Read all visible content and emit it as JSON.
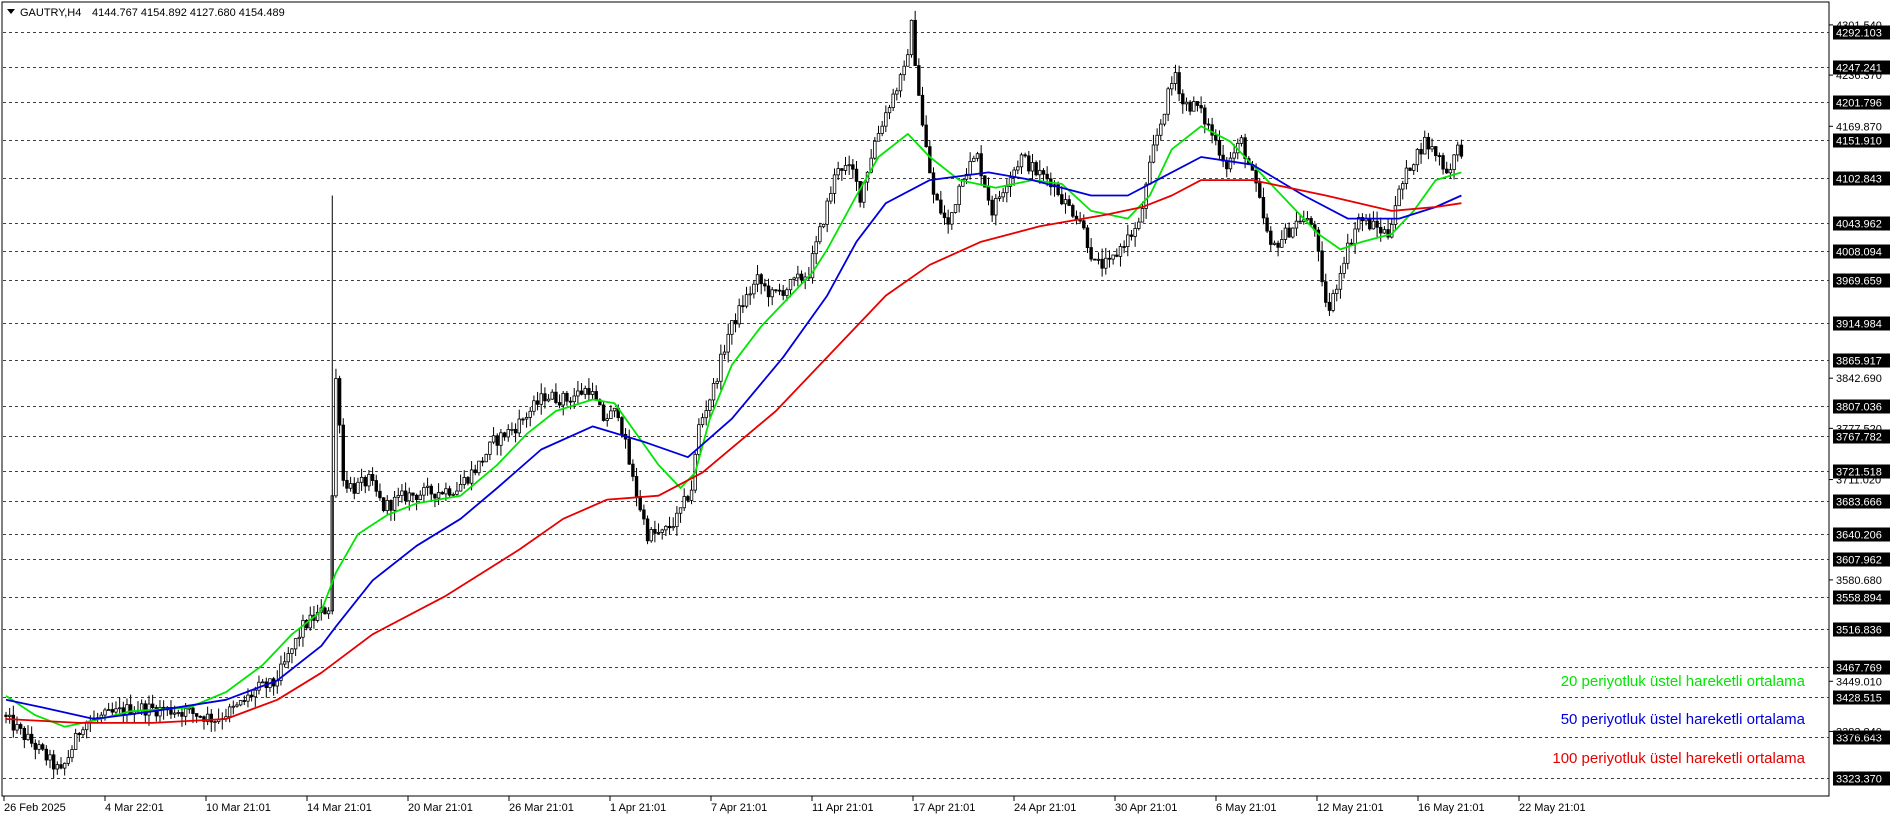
{
  "header": {
    "symbol": "GAUTRY,H4",
    "ohlc": "4144.767 4154.892 4127.680 4154.489"
  },
  "colors": {
    "background": "#ffffff",
    "grid": "#000000",
    "candle": "#000000",
    "ema20": "#00e600",
    "ema50": "#0000dd",
    "ema100": "#e60000"
  },
  "chart_data": {
    "type": "line",
    "timeframe": "H4",
    "ylim": [
      3300,
      4330
    ],
    "grid": true,
    "legend_position": "bottom-right",
    "price_levels": [
      4292.103,
      4247.241,
      4201.796,
      4151.91,
      4102.843,
      4043.962,
      4008.094,
      3969.659,
      3914.984,
      3865.917,
      3807.036,
      3767.782,
      3721.518,
      3683.666,
      3640.206,
      3607.962,
      3558.894,
      3516.836,
      3467.769,
      3428.515,
      3376.643,
      3323.37
    ],
    "scale_labels": [
      "4301.540",
      "4236.370",
      "4169.870",
      "3842.690",
      "3777.520",
      "3711.020",
      "3580.680",
      "3449.010",
      "3383.840"
    ],
    "x_labels": [
      "26 Feb 2025",
      "4 Mar 22:01",
      "10 Mar 21:01",
      "14 Mar 21:01",
      "20 Mar 21:01",
      "26 Mar 21:01",
      "1 Apr 21:01",
      "7 Apr 21:01",
      "11 Apr 21:01",
      "17 Apr 21:01",
      "24 Apr 21:01",
      "30 Apr 21:01",
      "6 May 21:01",
      "12 May 21:01",
      "16 May 21:01",
      "22 May 21:01"
    ],
    "price_path": [
      [
        0,
        3405
      ],
      [
        10,
        3360
      ],
      [
        16,
        3330
      ],
      [
        22,
        3395
      ],
      [
        36,
        3415
      ],
      [
        50,
        3410
      ],
      [
        58,
        3400
      ],
      [
        64,
        3415
      ],
      [
        70,
        3440
      ],
      [
        74,
        3445
      ],
      [
        78,
        3480
      ],
      [
        82,
        3520
      ],
      [
        86,
        3535
      ],
      [
        89,
        3545
      ],
      [
        90,
        3690
      ],
      [
        91,
        3840
      ],
      [
        92,
        3790
      ],
      [
        93,
        3710
      ],
      [
        96,
        3700
      ],
      [
        100,
        3710
      ],
      [
        104,
        3675
      ],
      [
        110,
        3690
      ],
      [
        118,
        3695
      ],
      [
        124,
        3700
      ],
      [
        130,
        3730
      ],
      [
        134,
        3760
      ],
      [
        140,
        3780
      ],
      [
        144,
        3800
      ],
      [
        148,
        3820
      ],
      [
        154,
        3815
      ],
      [
        160,
        3830
      ],
      [
        164,
        3790
      ],
      [
        168,
        3800
      ],
      [
        172,
        3710
      ],
      [
        176,
        3640
      ],
      [
        180,
        3640
      ],
      [
        184,
        3660
      ],
      [
        188,
        3700
      ],
      [
        190,
        3780
      ],
      [
        194,
        3830
      ],
      [
        198,
        3900
      ],
      [
        202,
        3940
      ],
      [
        206,
        3970
      ],
      [
        210,
        3950
      ],
      [
        214,
        3960
      ],
      [
        220,
        3980
      ],
      [
        224,
        4050
      ],
      [
        228,
        4120
      ],
      [
        232,
        4110
      ],
      [
        234,
        4080
      ],
      [
        238,
        4150
      ],
      [
        242,
        4200
      ],
      [
        246,
        4240
      ],
      [
        248,
        4300
      ],
      [
        251,
        4170
      ],
      [
        254,
        4080
      ],
      [
        258,
        4040
      ],
      [
        262,
        4110
      ],
      [
        266,
        4130
      ],
      [
        270,
        4060
      ],
      [
        274,
        4100
      ],
      [
        278,
        4130
      ],
      [
        282,
        4110
      ],
      [
        286,
        4100
      ],
      [
        290,
        4070
      ],
      [
        294,
        4050
      ],
      [
        298,
        3990
      ],
      [
        302,
        3990
      ],
      [
        306,
        4020
      ],
      [
        310,
        4040
      ],
      [
        314,
        4140
      ],
      [
        318,
        4210
      ],
      [
        320,
        4240
      ],
      [
        322,
        4200
      ],
      [
        326,
        4195
      ],
      [
        330,
        4160
      ],
      [
        334,
        4120
      ],
      [
        338,
        4150
      ],
      [
        342,
        4090
      ],
      [
        346,
        4010
      ],
      [
        350,
        4030
      ],
      [
        354,
        4050
      ],
      [
        358,
        4040
      ],
      [
        360,
        3960
      ],
      [
        362,
        3930
      ],
      [
        366,
        4000
      ],
      [
        370,
        4050
      ],
      [
        374,
        4040
      ],
      [
        378,
        4030
      ],
      [
        380,
        4070
      ],
      [
        384,
        4120
      ],
      [
        388,
        4150
      ],
      [
        392,
        4130
      ],
      [
        394,
        4110
      ],
      [
        397,
        4140
      ]
    ],
    "series": [
      {
        "name": "20 periyotluk üstel hareketli ortalama",
        "color": "#00e600",
        "values": [
          [
            0,
            3430
          ],
          [
            8,
            3405
          ],
          [
            16,
            3390
          ],
          [
            24,
            3398
          ],
          [
            34,
            3410
          ],
          [
            50,
            3415
          ],
          [
            60,
            3435
          ],
          [
            70,
            3470
          ],
          [
            78,
            3510
          ],
          [
            86,
            3540
          ],
          [
            90,
            3590
          ],
          [
            96,
            3640
          ],
          [
            104,
            3665
          ],
          [
            112,
            3680
          ],
          [
            124,
            3690
          ],
          [
            134,
            3730
          ],
          [
            142,
            3770
          ],
          [
            150,
            3800
          ],
          [
            160,
            3815
          ],
          [
            166,
            3810
          ],
          [
            172,
            3770
          ],
          [
            178,
            3730
          ],
          [
            184,
            3700
          ],
          [
            188,
            3720
          ],
          [
            192,
            3790
          ],
          [
            198,
            3860
          ],
          [
            206,
            3910
          ],
          [
            214,
            3950
          ],
          [
            220,
            3980
          ],
          [
            224,
            4010
          ],
          [
            232,
            4080
          ],
          [
            238,
            4130
          ],
          [
            246,
            4160
          ],
          [
            252,
            4130
          ],
          [
            260,
            4100
          ],
          [
            270,
            4090
          ],
          [
            280,
            4100
          ],
          [
            288,
            4095
          ],
          [
            296,
            4060
          ],
          [
            306,
            4050
          ],
          [
            312,
            4080
          ],
          [
            318,
            4140
          ],
          [
            326,
            4170
          ],
          [
            334,
            4150
          ],
          [
            342,
            4110
          ],
          [
            350,
            4070
          ],
          [
            358,
            4030
          ],
          [
            364,
            4010
          ],
          [
            370,
            4020
          ],
          [
            378,
            4030
          ],
          [
            384,
            4060
          ],
          [
            390,
            4100
          ],
          [
            397,
            4110
          ]
        ]
      },
      {
        "name": "50 periyotluk üstel hareketli ortalama",
        "color": "#0000dd",
        "values": [
          [
            0,
            3425
          ],
          [
            10,
            3415
          ],
          [
            24,
            3400
          ],
          [
            40,
            3410
          ],
          [
            60,
            3425
          ],
          [
            74,
            3450
          ],
          [
            86,
            3495
          ],
          [
            90,
            3520
          ],
          [
            100,
            3580
          ],
          [
            112,
            3625
          ],
          [
            124,
            3660
          ],
          [
            134,
            3700
          ],
          [
            146,
            3750
          ],
          [
            160,
            3780
          ],
          [
            174,
            3760
          ],
          [
            186,
            3740
          ],
          [
            198,
            3790
          ],
          [
            212,
            3870
          ],
          [
            224,
            3950
          ],
          [
            232,
            4020
          ],
          [
            240,
            4070
          ],
          [
            252,
            4100
          ],
          [
            268,
            4110
          ],
          [
            280,
            4100
          ],
          [
            296,
            4080
          ],
          [
            306,
            4080
          ],
          [
            314,
            4100
          ],
          [
            326,
            4130
          ],
          [
            340,
            4120
          ],
          [
            354,
            4080
          ],
          [
            366,
            4050
          ],
          [
            380,
            4050
          ],
          [
            390,
            4065
          ],
          [
            397,
            4080
          ]
        ]
      },
      {
        "name": "100 periyotluk üstel hareketli ortalama",
        "color": "#e60000",
        "values": [
          [
            0,
            3400
          ],
          [
            20,
            3395
          ],
          [
            40,
            3395
          ],
          [
            60,
            3400
          ],
          [
            74,
            3425
          ],
          [
            86,
            3460
          ],
          [
            100,
            3510
          ],
          [
            120,
            3560
          ],
          [
            140,
            3620
          ],
          [
            152,
            3660
          ],
          [
            164,
            3685
          ],
          [
            178,
            3690
          ],
          [
            190,
            3720
          ],
          [
            210,
            3800
          ],
          [
            226,
            3880
          ],
          [
            240,
            3950
          ],
          [
            252,
            3990
          ],
          [
            266,
            4020
          ],
          [
            282,
            4040
          ],
          [
            300,
            4055
          ],
          [
            310,
            4065
          ],
          [
            318,
            4080
          ],
          [
            326,
            4100
          ],
          [
            340,
            4100
          ],
          [
            360,
            4080
          ],
          [
            378,
            4060
          ],
          [
            390,
            4065
          ],
          [
            397,
            4070
          ]
        ]
      }
    ]
  }
}
